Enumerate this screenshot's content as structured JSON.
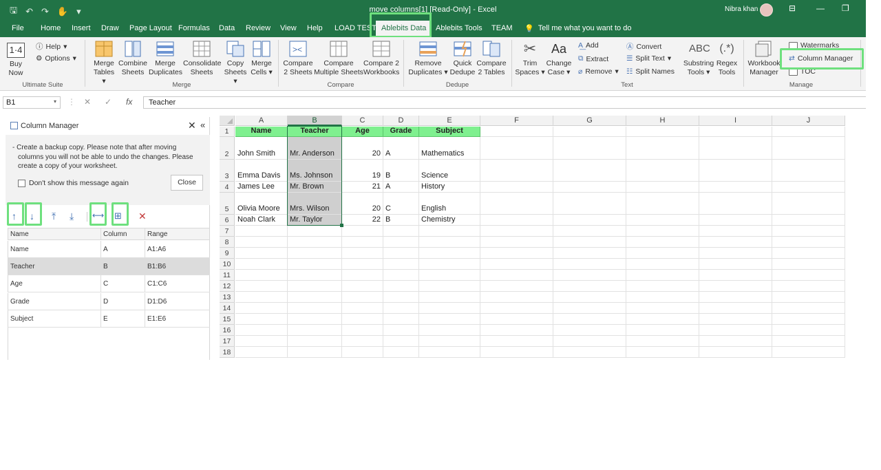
{
  "window": {
    "title": "move columns[1]  [Read-Only]  -  Excel",
    "user": "Nibra khan"
  },
  "tabs": [
    "File",
    "Home",
    "Insert",
    "Draw",
    "Page Layout",
    "Formulas",
    "Data",
    "Review",
    "View",
    "Help",
    "LOAD TEST",
    "Ablebits Data",
    "Ablebits Tools",
    "TEAM"
  ],
  "active_tab": "Ablebits Data",
  "tell_me": "Tell me what you want to do",
  "ribbon": {
    "ultimate": {
      "buy": [
        "Buy",
        "Now"
      ],
      "help": "Help",
      "options": "Options",
      "group": "Ultimate Suite"
    },
    "merge": {
      "buttons": [
        [
          "Merge",
          "Tables"
        ],
        [
          "Combine",
          "Sheets"
        ],
        [
          "Merge",
          "Duplicates"
        ],
        [
          "Consolidate",
          "Sheets"
        ],
        [
          "Copy",
          "Sheets"
        ],
        [
          "Merge",
          "Cells"
        ]
      ],
      "group": "Merge"
    },
    "compare": {
      "buttons": [
        [
          "Compare",
          "2 Sheets"
        ],
        [
          "Compare",
          "Multiple Sheets"
        ],
        [
          "Compare 2",
          "Workbooks"
        ]
      ],
      "group": "Compare"
    },
    "dedupe": {
      "buttons": [
        [
          "Remove",
          "Duplicates"
        ],
        [
          "Quick",
          "Dedupe"
        ],
        [
          "Compare",
          "2 Tables"
        ]
      ],
      "group": "Dedupe"
    },
    "text": {
      "buttons": [
        [
          "Trim",
          "Spaces"
        ],
        [
          "Change",
          "Case"
        ]
      ],
      "small": [
        "Add",
        "Extract",
        "Remove",
        "Convert",
        "Split Text",
        "Split Names"
      ],
      "more": [
        [
          "Substring",
          "Tools"
        ],
        [
          "Regex",
          "Tools"
        ]
      ],
      "group": "Text"
    },
    "manage": {
      "workbook": [
        "Workbook",
        "Manager"
      ],
      "small": [
        "Watermarks",
        "Column Manager",
        "TOC"
      ],
      "group": "Manage"
    }
  },
  "formula_bar": {
    "name_box": "B1",
    "value": "Teacher"
  },
  "pane": {
    "title": "Column Manager",
    "notice": "- Create a backup copy. Please note that after moving columns you will not be able to undo the changes. Please create a copy of your worksheet.",
    "dont_show": "Don't show this message again",
    "close": "Close",
    "headers": [
      "Name",
      "Column",
      "Range"
    ],
    "rows": [
      {
        "name": "Name",
        "column": "A",
        "range": "A1:A6"
      },
      {
        "name": "Teacher",
        "column": "B",
        "range": "B1:B6"
      },
      {
        "name": "Age",
        "column": "C",
        "range": "C1:C6"
      },
      {
        "name": "Grade",
        "column": "D",
        "range": "D1:D6"
      },
      {
        "name": "Subject",
        "column": "E",
        "range": "E1:E6"
      }
    ]
  },
  "sheet": {
    "columns": [
      "A",
      "B",
      "C",
      "D",
      "E",
      "F",
      "G",
      "H",
      "I",
      "J"
    ],
    "header_row": [
      "Name",
      "Teacher",
      "Age",
      "Grade",
      "Subject"
    ],
    "data": [
      [
        "John Smith",
        "Mr. Anderson",
        "20",
        "A",
        "Mathematics"
      ],
      [
        "Emma Davis",
        "Ms. Johnson",
        "19",
        "B",
        "Science"
      ],
      [
        "James Lee",
        "Mr. Brown",
        "21",
        "A",
        "History"
      ],
      [
        "Olivia Moore",
        "Mrs. Wilson",
        "20",
        "C",
        "English"
      ],
      [
        "Noah Clark",
        "Mr. Taylor",
        "22",
        "B",
        "Chemistry"
      ]
    ],
    "row_numbers": [
      "1",
      "2",
      "3",
      "4",
      "5",
      "6",
      "7",
      "8",
      "9",
      "10",
      "11",
      "12",
      "13",
      "14",
      "15",
      "16",
      "17",
      "18"
    ]
  },
  "colors": {
    "excel_green": "#217346",
    "highlight": "#6ee07e",
    "header_fill": "#7ff08f"
  }
}
